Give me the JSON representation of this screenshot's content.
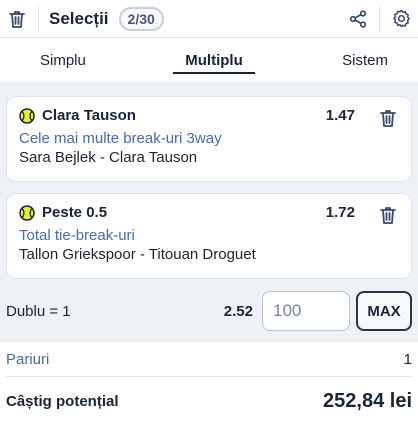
{
  "header": {
    "title": "Selecții",
    "count": "2/30",
    "icons": {
      "delete_all": "trash-icon",
      "share": "share-icon",
      "settings": "gear-icon"
    }
  },
  "tabs": [
    {
      "label": "Simplu",
      "active": false
    },
    {
      "label": "Multiplu",
      "active": true
    },
    {
      "label": "Sistem",
      "active": false
    }
  ],
  "selections": [
    {
      "name": "Clara Tauson",
      "odds": "1.47",
      "market": "Cele mai multe break-uri 3way",
      "event": "Sara Bejlek - Clara Tauson",
      "sport_icon": "tennis-ball-icon"
    },
    {
      "name": "Peste 0.5",
      "odds": "1.72",
      "market": "Total tie-break-uri",
      "event": "Tallon Griekspoor - Titouan Droguet",
      "sport_icon": "tennis-ball-icon"
    }
  ],
  "stake": {
    "bet_type": "Dublu = 1",
    "total_odds": "2.52",
    "placeholder": "100",
    "max_label": "MAX"
  },
  "summary": {
    "bets_label": "Pariuri",
    "bets_value": "1",
    "win_label": "Câștig potențial",
    "win_value": "252,84 lei"
  },
  "colors": {
    "accent_blue": "#4a6aa8",
    "tennis_ball": "#e3ee3a",
    "text_dark": "#1a2433"
  }
}
